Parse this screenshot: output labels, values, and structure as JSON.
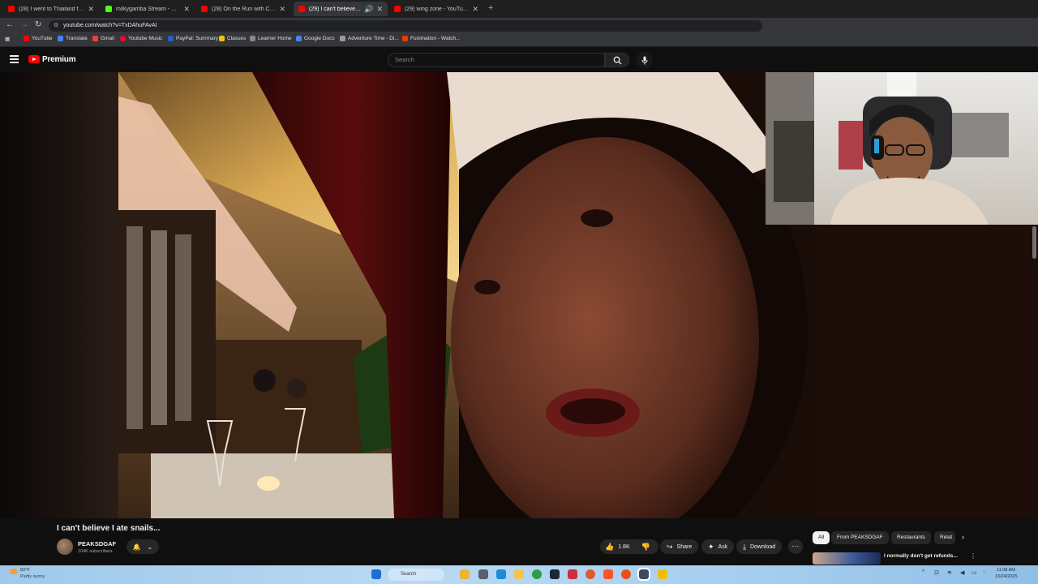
{
  "browser": {
    "tabs": [
      {
        "label": "(28) I went to Thailand for MUA",
        "favicon_color": "#ff0000",
        "active": false
      },
      {
        "label": "milkygamba Stream - Watch Li",
        "favicon_color": "#53fc18",
        "active": false
      },
      {
        "label": "(28) On the Run with California",
        "favicon_color": "#ff0000",
        "active": false
      },
      {
        "label": "(29) I can't believe I ate snai",
        "favicon_color": "#ff0000",
        "active": true
      },
      {
        "label": "(29) wing zone - YouTube",
        "favicon_color": "#ff0000",
        "active": false
      }
    ],
    "new_tab_glyph": "+",
    "url": "youtube.com/watch?v=TxDAhuFAvAI",
    "bookmarks": [
      {
        "label": "YouTube",
        "color": "#ff0000"
      },
      {
        "label": "Translate",
        "color": "#4285f4"
      },
      {
        "label": "Gmail",
        "color": "#ea4335"
      },
      {
        "label": "Youtube Music",
        "color": "#ff0033"
      },
      {
        "label": "PayPal: Summary",
        "color": "#1f64c0"
      },
      {
        "label": "Classes",
        "color": "#f4c20d"
      },
      {
        "label": "Learner Home",
        "color": "#888888"
      },
      {
        "label": "Google Docs",
        "color": "#4285f4"
      },
      {
        "label": "Adventure Time - Di...",
        "color": "#999999"
      },
      {
        "label": "Funimation - Watch...",
        "color": "#ff3300"
      }
    ]
  },
  "youtube": {
    "brand": "Premium",
    "search_placeholder": "Search",
    "video_title": "I can't believe I ate snails...",
    "channel_name": "PEAKSDGAF",
    "subscribers": "104K subscribers",
    "like_count": "1.8K",
    "actions": {
      "share": "Share",
      "ask": "Ask",
      "download": "Download"
    },
    "chips": [
      {
        "label": "All",
        "selected": true
      },
      {
        "label": "From PEAKSDGAF",
        "selected": false
      },
      {
        "label": "Restaurants",
        "selected": false
      },
      {
        "label": "Relat",
        "selected": false
      }
    ],
    "recommendation_title": "I normally don't get refunds..."
  },
  "taskbar": {
    "temperature": "83°F",
    "weather": "Partly sunny",
    "search_label": "Search",
    "time": "11:08 AM",
    "date": "10/24/2025"
  },
  "colors": {
    "accent": "#ff0000",
    "background": "#0f0f0f",
    "pill": "#272727"
  }
}
